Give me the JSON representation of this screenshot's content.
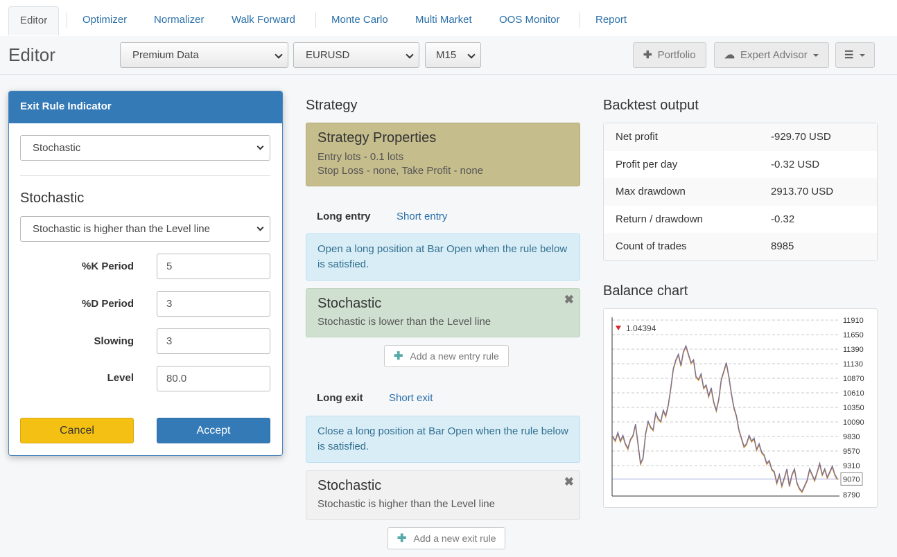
{
  "nav": {
    "tabs": [
      {
        "label": "Editor",
        "active": true
      },
      {
        "label": "Optimizer"
      },
      {
        "label": "Normalizer"
      },
      {
        "label": "Walk Forward"
      },
      {
        "label": "Monte Carlo"
      },
      {
        "label": "Multi Market"
      },
      {
        "label": "OOS Monitor"
      },
      {
        "label": "Report"
      }
    ]
  },
  "toolbar": {
    "title": "Editor",
    "data_source": "Premium Data",
    "symbol": "EURUSD",
    "period": "M15",
    "portfolio_label": "Portfolio",
    "expert_advisor_label": "Expert Advisor"
  },
  "dialog": {
    "title": "Exit Rule Indicator",
    "indicator": "Stochastic",
    "subtitle": "Stochastic",
    "logic": "Stochastic is higher than the Level line",
    "fields": [
      {
        "label": "%K Period",
        "value": "5"
      },
      {
        "label": "%D Period",
        "value": "3"
      },
      {
        "label": "Slowing",
        "value": "3"
      },
      {
        "label": "Level",
        "value": "80.0"
      }
    ],
    "cancel_label": "Cancel",
    "accept_label": "Accept"
  },
  "strategy": {
    "heading": "Strategy",
    "properties": {
      "title": "Strategy Properties",
      "line1": "Entry lots - 0.1 lots",
      "line2": "Stop Loss - none, Take Profit - none"
    },
    "entry_tabs": {
      "long": "Long entry",
      "short": "Short entry"
    },
    "entry_info": "Open a long position at Bar Open when the rule below is satisfied.",
    "entry_rule": {
      "title": "Stochastic",
      "desc": "Stochastic is lower than the Level line"
    },
    "add_entry_label": "Add a new entry rule",
    "exit_tabs": {
      "long": "Long exit",
      "short": "Short exit"
    },
    "exit_info": "Close a long position at Bar Open when the rule below is satisfied.",
    "exit_rule": {
      "title": "Stochastic",
      "desc": "Stochastic is higher than the Level line"
    },
    "add_exit_label": "Add a new exit rule"
  },
  "backtest": {
    "heading": "Backtest output",
    "rows": [
      {
        "k": "Net profit",
        "v": "-929.70 USD"
      },
      {
        "k": "Profit per day",
        "v": "-0.32 USD"
      },
      {
        "k": "Max drawdown",
        "v": "2913.70 USD"
      },
      {
        "k": "Return / drawdown",
        "v": "-0.32"
      },
      {
        "k": "Count of trades",
        "v": "8985"
      }
    ]
  },
  "balance": {
    "heading": "Balance chart",
    "chart_data": {
      "type": "line",
      "marker_label": "1.04394",
      "y_ticks": [
        11910,
        11650,
        11390,
        11130,
        10870,
        10610,
        10350,
        10090,
        9830,
        9570,
        9310,
        9070,
        8790
      ],
      "current_value": 9070,
      "ylim": [
        8790,
        11910
      ],
      "series": [
        {
          "values": [
            9830,
            9760,
            9900,
            9750,
            9850,
            9700,
            9620,
            9780,
            9850,
            10050,
            9700,
            9350,
            9450,
            9880,
            10100,
            10000,
            9950,
            10250,
            10150,
            10100,
            10300,
            10200,
            10400,
            10700,
            11050,
            11200,
            11300,
            11100,
            11350,
            11450,
            11300,
            11150,
            11200,
            10900,
            10850,
            10950,
            10700,
            10750,
            10550,
            10700,
            10450,
            10300,
            10500,
            10850,
            11000,
            11150,
            10900,
            10600,
            10350,
            10200,
            9950,
            9800,
            9650,
            9700,
            9850,
            9750,
            9800,
            9600,
            9700,
            9550,
            9500,
            9350,
            9400,
            9250,
            9200,
            9000,
            9150,
            8950,
            9100,
            9250,
            8950,
            9150,
            9250,
            9000,
            8900,
            8850,
            8950,
            9050,
            9250,
            9150,
            9050,
            9200,
            9350,
            9150,
            9250,
            9100,
            9200,
            9300,
            9150,
            9070
          ]
        }
      ]
    }
  }
}
